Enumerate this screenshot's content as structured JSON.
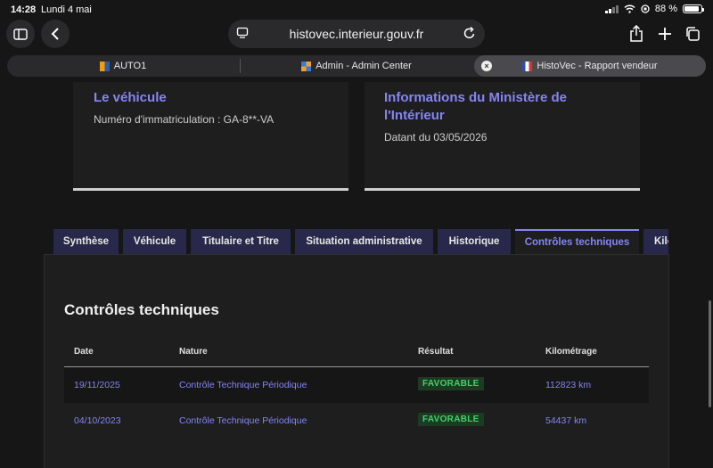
{
  "status": {
    "time": "14:28",
    "date": "Lundi 4 mai",
    "battery": "88 %",
    "battery_level": 0.88
  },
  "browser": {
    "url": "histovec.interieur.gouv.fr",
    "tabs": [
      {
        "label": "AUTO1",
        "active": false
      },
      {
        "label": "Admin - Admin Center",
        "active": false
      },
      {
        "label": "HistoVec - Rapport vendeur",
        "active": true
      }
    ],
    "icons": {
      "sidebar": "sidebar-icon",
      "back": "chevron-left-icon",
      "reader": "reader-icon",
      "reload": "reload-icon",
      "share": "share-icon",
      "new_tab": "plus-icon",
      "tabs": "tabs-overview-icon",
      "close": "close-icon"
    }
  },
  "cards": {
    "vehicle": {
      "title": "Le véhicule",
      "text": "Numéro d'immatriculation : GA-8**-VA"
    },
    "ministry": {
      "title": "Informations du Ministère de l'Intérieur",
      "text": "Datant du 03/05/2026"
    }
  },
  "page_tabs": [
    {
      "label": "Synthèse"
    },
    {
      "label": "Véhicule"
    },
    {
      "label": "Titulaire et Titre"
    },
    {
      "label": "Situation administrative"
    },
    {
      "label": "Historique"
    },
    {
      "label": "Contrôles techniques"
    },
    {
      "label": "Kilométrage"
    }
  ],
  "active_tab": "Contrôles techniques",
  "section": {
    "title": "Contrôles techniques",
    "columns": [
      "Date",
      "Nature",
      "Résultat",
      "Kilométrage"
    ],
    "rows": [
      {
        "date": "19/11/2025",
        "nature": "Contrôle Technique Périodique",
        "result": "FAVORABLE",
        "km": "112823 km"
      },
      {
        "date": "04/10/2023",
        "nature": "Contrôle Technique Périodique",
        "result": "FAVORABLE",
        "km": "54437 km"
      }
    ]
  },
  "colors": {
    "accent": "#8585f6",
    "favorable": "#3fd36b",
    "tab_bg": "#28284a"
  }
}
